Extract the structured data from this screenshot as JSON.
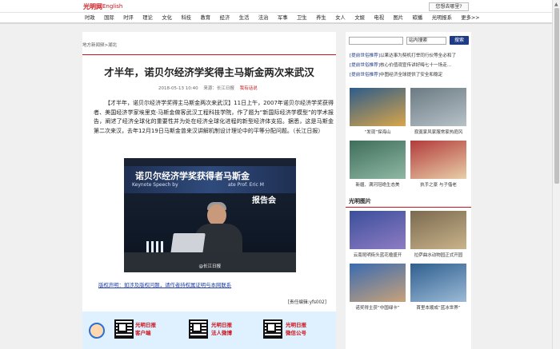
{
  "header": {
    "logo": "光明网",
    "english_link": "English",
    "where_button": "您想去哪里?"
  },
  "nav": {
    "items": [
      "时政",
      "国际",
      "时评",
      "理论",
      "文化",
      "科技",
      "教育",
      "经济",
      "生活",
      "法治",
      "军事",
      "卫生",
      "养生",
      "女人",
      "文娱",
      "电视",
      "图片",
      "碳播",
      "光明报系",
      "更多>>"
    ]
  },
  "article": {
    "breadcrumb": "地方新闻频>湖北",
    "title": "才半年，诺贝尔经济学奖得主马斯金两次来武汉",
    "date": "2018-05-13 10:40",
    "source": "来源：长江日报",
    "comment_link": "我有话说",
    "body": "【才半年，诺贝尔经济学奖得主马斯金两次来武汉】11日上午，2007年诺贝尔经济学奖获得者、美国经济学家埃里克·马斯金做客武汉工程科技学院，作了题为“新国际经济学模型”的学术报告，阐述了经济全球化的重要性并为处在经济全球化进程的新型经济体支招。据悉，这是马斯金第二次来汉，去年12月19日马斯金曾来汉讲解机制设计理论中的平等分配问题。（长江日报）",
    "photo": {
      "line1": "诺贝尔经济学奖获得者马斯金",
      "line2_left": "Keynote Speech by",
      "line2_right": "ate Prof. Eric M",
      "line3": "报告会",
      "watermark": "@长江日报"
    },
    "copyright": "版权声明：如涉及版权问题，请作者持权属证明与本网联系",
    "editor": "[责任编辑:yfs002]",
    "banner": [
      {
        "label1": "光明日报",
        "label2": "客户端"
      },
      {
        "label1": "光明日报",
        "label2": "法人微博"
      },
      {
        "label1": "光明日报",
        "label2": "微信公号"
      }
    ]
  },
  "sidebar": {
    "search": {
      "placeholder": "",
      "select_value": "站内搜索",
      "button": "搜索"
    },
    "announcements": [
      {
        "tag": "[提前世俗推荐]",
        "text": "以果达事为契机打举同行伙等全必和了"
      },
      {
        "tag": "[提前世俗推荐]",
        "text": "核心价值观宣传讲好晦七十一场走..."
      },
      {
        "tag": "[提前世俗推荐]",
        "text": "中图经济全球提供了安全和稳定"
      }
    ],
    "top_thumbs": [
      {
        "caption": "“发现”探海山",
        "color_a": "#2d5c8a",
        "color_b": "#d9a54a"
      },
      {
        "caption": "寂寞家风家服常家热庭风",
        "color_a": "#6b7a83",
        "color_b": "#b7c2c8"
      },
      {
        "caption": "新疆、满河冠绝生态美",
        "color_a": "#3e6e5b",
        "color_b": "#8fb8a4"
      },
      {
        "caption": "执手之豪 与子偕老",
        "color_a": "#b33b3b",
        "color_b": "#e8cfa8"
      }
    ],
    "photo_section_title": "光明图片",
    "photo_thumbs": [
      {
        "caption": "云南昆明街头蓝花楹盛开",
        "color_a": "#3b4f9b",
        "color_b": "#8e7cc3"
      },
      {
        "caption": "拉萨曲水动物园正式开园",
        "color_a": "#7a6a4f",
        "color_b": "#c9b38a"
      },
      {
        "caption": "诺奖得主获“中国绿卡”",
        "color_a": "#3a6bb0",
        "color_b": "#c8a27a"
      },
      {
        "caption": "首里本顺成“蓝冰世界”",
        "color_a": "#2f5f8f",
        "color_b": "#9bbad6"
      }
    ]
  }
}
